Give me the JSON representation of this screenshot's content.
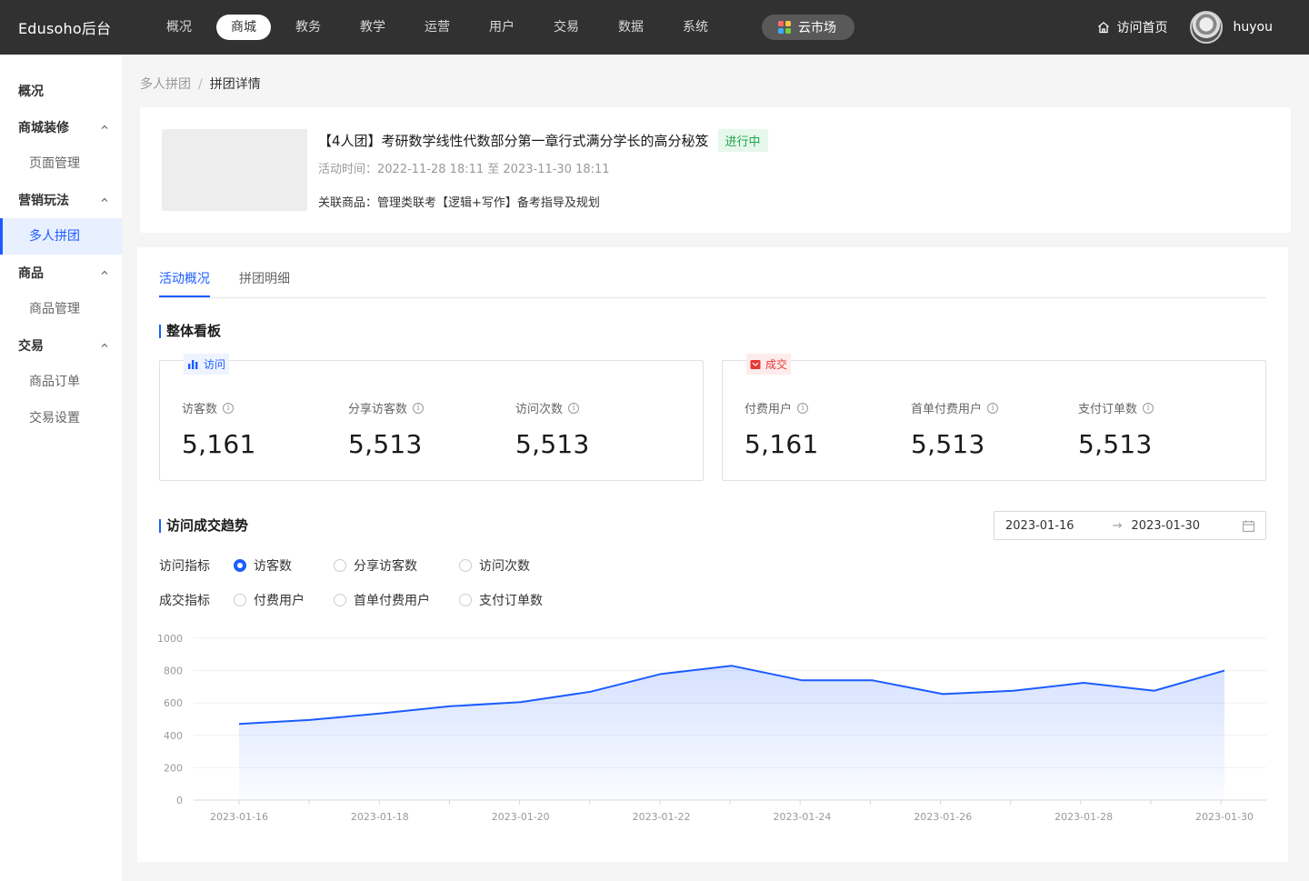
{
  "app": {
    "logo": "Edusoho后台"
  },
  "topnav": {
    "items": [
      "概况",
      "商城",
      "教务",
      "教学",
      "运营",
      "用户",
      "交易",
      "数据",
      "系统"
    ],
    "active_index": 1,
    "market_label": "云市场",
    "home_label": "访问首页",
    "username": "huyou"
  },
  "sidebar": {
    "overview": "概况",
    "groups": [
      {
        "label": "商城装修",
        "items": [
          "页面管理"
        ]
      },
      {
        "label": "营销玩法",
        "items": [
          "多人拼团"
        ]
      },
      {
        "label": "商品",
        "items": [
          "商品管理"
        ]
      },
      {
        "label": "交易",
        "items": [
          "商品订单",
          "交易设置"
        ]
      }
    ],
    "active_item": "多人拼团"
  },
  "breadcrumb": {
    "parent": "多人拼团",
    "separator": "/",
    "current": "拼团详情"
  },
  "activity": {
    "title": "【4人团】考研数学线性代数部分第一章行式满分学长的高分秘笈",
    "status": "进行中",
    "time": "活动时间：2022-11-28 18:11 至 2023-11-30 18:11",
    "goods": "关联商品：管理类联考【逻辑+写作】备考指导及规划"
  },
  "tabs": {
    "overview": "活动概况",
    "detail": "拼团明细"
  },
  "dashboard": {
    "title": "整体看板",
    "visit": {
      "badge": "访问",
      "stats": [
        {
          "label": "访客数",
          "value": "5,161"
        },
        {
          "label": "分享访客数",
          "value": "5,513"
        },
        {
          "label": "访问次数",
          "value": "5,513"
        }
      ]
    },
    "deal": {
      "badge": "成交",
      "stats": [
        {
          "label": "付费用户",
          "value": "5,161"
        },
        {
          "label": "首单付费用户",
          "value": "5,513"
        },
        {
          "label": "支付订单数",
          "value": "5,513"
        }
      ]
    }
  },
  "trend": {
    "title": "访问成交趋势",
    "date_start": "2023-01-16",
    "date_end": "2023-01-30",
    "visit_metric_label": "访问指标",
    "visit_options": [
      "访客数",
      "分享访客数",
      "访问次数"
    ],
    "visit_selected": 0,
    "deal_metric_label": "成交指标",
    "deal_options": [
      "付费用户",
      "首单付费用户",
      "支付订单数"
    ]
  },
  "colors": {
    "accent": "#1c5cff",
    "topbar": "#313131",
    "success": "#1ea64a",
    "danger": "#e53935"
  },
  "chart_data": {
    "type": "area",
    "x": [
      "2023-01-16",
      "2023-01-17",
      "2023-01-18",
      "2023-01-19",
      "2023-01-20",
      "2023-01-21",
      "2023-01-22",
      "2023-01-23",
      "2023-01-24",
      "2023-01-25",
      "2023-01-26",
      "2023-01-27",
      "2023-01-28",
      "2023-01-29",
      "2023-01-30"
    ],
    "x_tick_labels": [
      "2023-01-16",
      "2023-01-18",
      "2023-01-20",
      "2023-01-22",
      "2023-01-24",
      "2023-01-26",
      "2023-01-28",
      "2023-01-30"
    ],
    "series": [
      {
        "values": [
          470,
          495,
          535,
          580,
          605,
          670,
          780,
          830,
          740,
          740,
          655,
          675,
          725,
          675,
          800
        ]
      }
    ],
    "y_ticks": [
      0,
      200,
      400,
      600,
      800,
      1000
    ],
    "ylim": [
      0,
      1000
    ],
    "grid": true
  }
}
